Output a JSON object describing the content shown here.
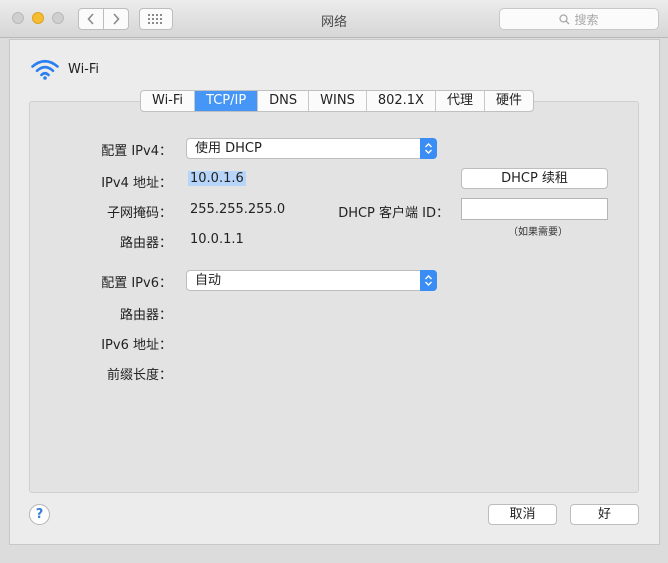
{
  "window": {
    "title": "网络"
  },
  "toolbar": {
    "search_placeholder": "搜索"
  },
  "header": {
    "interface_label": "Wi-Fi"
  },
  "tabs": [
    {
      "label": "Wi-Fi",
      "active": false
    },
    {
      "label": "TCP/IP",
      "active": true
    },
    {
      "label": "DNS",
      "active": false
    },
    {
      "label": "WINS",
      "active": false
    },
    {
      "label": "802.1X",
      "active": false
    },
    {
      "label": "代理",
      "active": false
    },
    {
      "label": "硬件",
      "active": false
    }
  ],
  "ipv4": {
    "config_label": "配置 IPv4：",
    "config_value": "使用 DHCP",
    "address_label": "IPv4 地址：",
    "address_value": "10.0.1.6",
    "subnet_label": "子网掩码：",
    "subnet_value": "255.255.255.0",
    "router_label": "路由器：",
    "router_value": "10.0.1.1",
    "renew_button": "DHCP 续租",
    "client_id_label": "DHCP 客户端 ID：",
    "client_id_value": "",
    "client_id_hint": "（如果需要）"
  },
  "ipv6": {
    "config_label": "配置 IPv6：",
    "config_value": "自动",
    "router_label": "路由器：",
    "address_label": "IPv6 地址：",
    "prefix_label": "前缀长度："
  },
  "footer": {
    "help_label": "?",
    "cancel_label": "取消",
    "ok_label": "好"
  },
  "colors": {
    "accent": "#4596f7",
    "selection": "#b7d5f8",
    "minimize": "#f5bd2f"
  },
  "icons": [
    "wifi-icon",
    "chevron-left-icon",
    "chevron-right-icon",
    "grid-icon",
    "search-icon",
    "popup-arrows-icon"
  ]
}
